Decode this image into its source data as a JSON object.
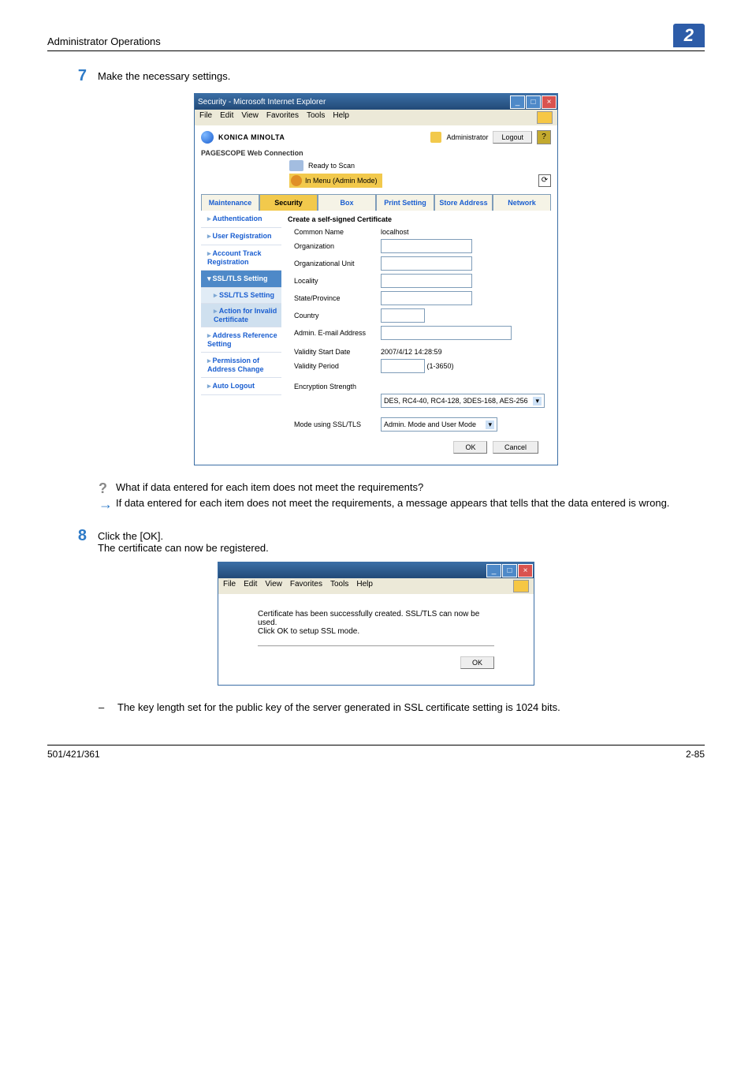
{
  "header": {
    "left": "Administrator Operations",
    "right": "2"
  },
  "steps": {
    "s7": {
      "num": "7",
      "text": "Make the necessary settings."
    },
    "s8": {
      "num": "8",
      "text": "Click the [OK].",
      "sub": "The certificate can now be registered."
    }
  },
  "win7": {
    "title": "Security - Microsoft Internet Explorer",
    "menu": [
      "File",
      "Edit",
      "View",
      "Favorites",
      "Tools",
      "Help"
    ],
    "brand": "KONICA MINOLTA",
    "product": "PAGESCOPE Web Connection",
    "admin": "Administrator",
    "logout": "Logout",
    "help": "?",
    "ready": "Ready to Scan",
    "mode": "In Menu (Admin Mode)",
    "tabs": [
      "Maintenance",
      "Security",
      "Box",
      "Print Setting",
      "Store Address",
      "Network"
    ],
    "active_tab": 1,
    "sidebar": [
      "Authentication",
      "User Registration",
      "Account Track Registration",
      "SSL/TLS Setting",
      "Address Reference Setting",
      "Permission of Address Change",
      "Auto Logout"
    ],
    "subitems": [
      "SSL/TLS Setting",
      "Action for Invalid Certificate"
    ],
    "form": {
      "section": "Create a self-signed Certificate",
      "rows": [
        {
          "label": "Common Name",
          "value": "localhost",
          "readonly": true
        },
        {
          "label": "Organization"
        },
        {
          "label": "Organizational Unit"
        },
        {
          "label": "Locality"
        },
        {
          "label": "State/Province"
        },
        {
          "label": "Country",
          "small": true
        },
        {
          "label": "Admin. E-mail Address",
          "wide": true
        }
      ],
      "validity_start_label": "Validity Start Date",
      "validity_start_value": "2007/4/12 14:28:59",
      "validity_period_label": "Validity Period",
      "validity_period_hint": "(1-3650)",
      "enc_label": "Encryption Strength",
      "enc_value": "DES, RC4-40, RC4-128, 3DES-168, AES-256",
      "mode_label": "Mode using SSL/TLS",
      "mode_value": "Admin. Mode and User Mode",
      "ok": "OK",
      "cancel": "Cancel"
    }
  },
  "qa": {
    "q": "What if data entered for each item does not meet the requirements?",
    "a": "If data entered for each item does not meet the requirements, a message appears that tells that the data entered is wrong."
  },
  "win8": {
    "menu": [
      "File",
      "Edit",
      "View",
      "Favorites",
      "Tools",
      "Help"
    ],
    "msg1": "Certificate has been successfully created. SSL/TLS can now be used.",
    "msg2": "Click OK to setup SSL mode.",
    "ok": "OK"
  },
  "note": "The key length set for the public key of the server generated in SSL certificate setting is 1024 bits.",
  "footer": {
    "left": "501/421/361",
    "right": "2-85"
  }
}
